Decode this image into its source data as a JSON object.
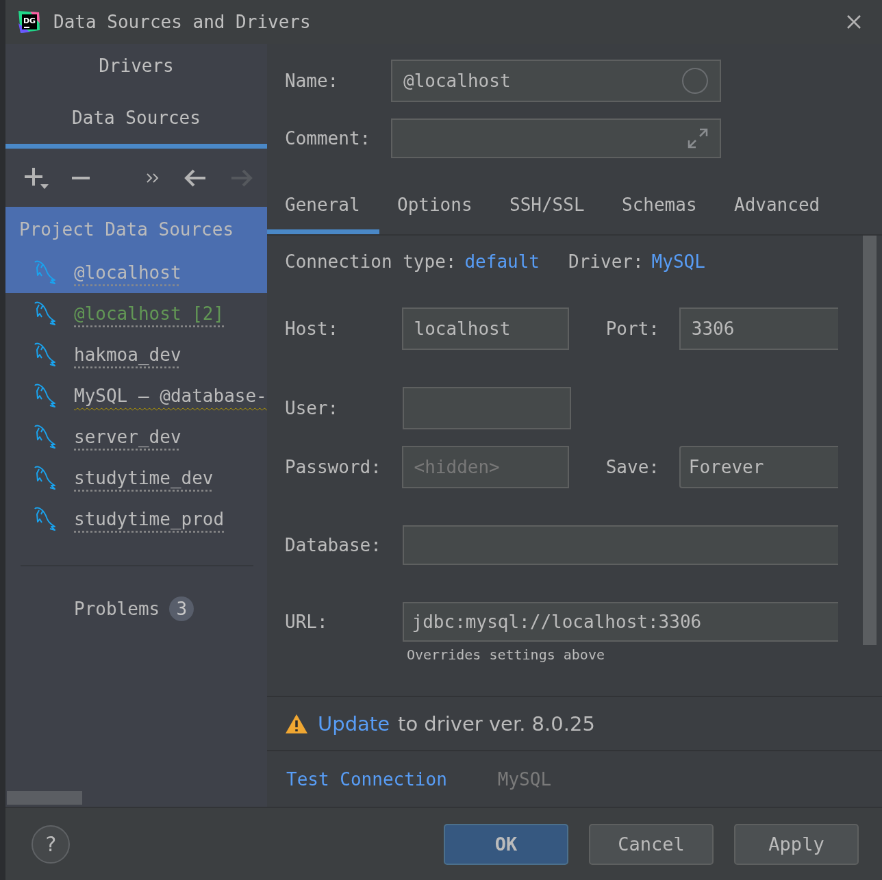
{
  "window": {
    "title": "Data Sources and Drivers",
    "logo": "DG"
  },
  "sidebar": {
    "tabs": [
      {
        "label": "Drivers",
        "selected": false
      },
      {
        "label": "Data Sources",
        "selected": true
      }
    ],
    "toolbar": [
      {
        "kind": "add",
        "disabled": false
      },
      {
        "kind": "remove",
        "disabled": false
      },
      {
        "kind": "more",
        "disabled": false
      },
      {
        "kind": "back",
        "disabled": false
      },
      {
        "kind": "forward",
        "disabled": true
      }
    ],
    "tree": {
      "label": "Project Data Sources",
      "selected": true,
      "children": [
        {
          "label": "@localhost",
          "selected": true,
          "kind": "normal"
        },
        {
          "label": "@localhost [2]",
          "selected": false,
          "kind": "new"
        },
        {
          "label": "hakmoa_dev",
          "selected": false,
          "kind": "normal"
        },
        {
          "label": "MySQL – @database-",
          "selected": false,
          "kind": "warning"
        },
        {
          "label": "server_dev",
          "selected": false,
          "kind": "normal"
        },
        {
          "label": "studytime_dev",
          "selected": false,
          "kind": "normal"
        },
        {
          "label": "studytime_prod",
          "selected": false,
          "kind": "normal"
        }
      ]
    },
    "problems": {
      "label": "Problems",
      "count": "3"
    }
  },
  "form": {
    "name": {
      "label": "Name:",
      "value": "@localhost"
    },
    "comment": {
      "label": "Comment:"
    },
    "tabs": [
      {
        "label": "General",
        "selected": true
      },
      {
        "label": "Options",
        "selected": false
      },
      {
        "label": "SSH/SSL",
        "selected": false
      },
      {
        "label": "Schemas",
        "selected": false
      },
      {
        "label": "Advanced",
        "selected": false
      }
    ],
    "connection_type": {
      "label": "Connection type:",
      "value": "default"
    },
    "driver": {
      "label": "Driver:",
      "value": "MySQL"
    },
    "host": {
      "label": "Host:",
      "value": "localhost"
    },
    "port": {
      "label": "Port:",
      "value": "3306"
    },
    "user": {
      "label": "User:"
    },
    "password": {
      "label": "Password:",
      "placeholder": "<hidden>"
    },
    "save": {
      "label": "Save:",
      "value": "Forever"
    },
    "database": {
      "label": "Database:"
    },
    "url": {
      "label": "URL:",
      "value": "jdbc:mysql://localhost:3306",
      "hint": "Overrides settings above"
    }
  },
  "notice": {
    "link": "Update",
    "text": "to driver ver. 8.0.25"
  },
  "test_connection": "Test Connection",
  "driver_name": "MySQL",
  "buttons": [
    {
      "label": "OK",
      "default": true
    },
    {
      "label": "Cancel",
      "default": false
    },
    {
      "label": "Apply",
      "default": false
    }
  ],
  "help": "?"
}
